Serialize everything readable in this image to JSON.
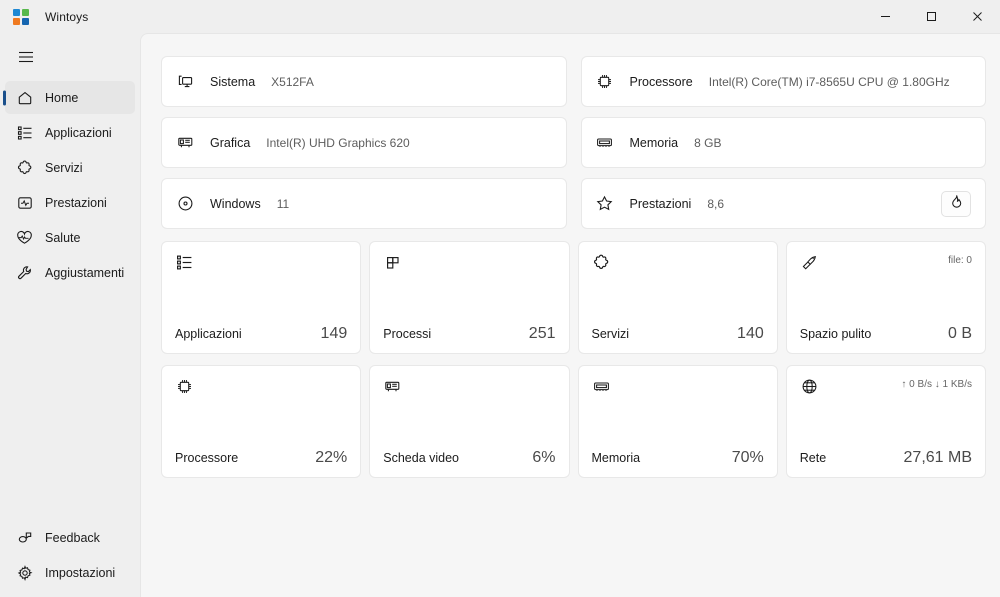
{
  "window": {
    "title": "Wintoys",
    "logo_icon": "wintoys-logo-icon",
    "minimize_label": "─",
    "maximize_label": "□",
    "close_label": "✕"
  },
  "sidebar": {
    "menu_toggle_icon": "hamburger-icon",
    "items": [
      {
        "label": "Home",
        "icon": "home-icon",
        "selected": true
      },
      {
        "label": "Applicazioni",
        "icon": "list-icon",
        "selected": false
      },
      {
        "label": "Servizi",
        "icon": "puzzle-icon",
        "selected": false
      },
      {
        "label": "Prestazioni",
        "icon": "pulse-icon",
        "selected": false
      },
      {
        "label": "Salute",
        "icon": "heart-pulse-icon",
        "selected": false
      },
      {
        "label": "Aggiustamenti",
        "icon": "wrench-icon",
        "selected": false
      }
    ],
    "bottom_items": [
      {
        "label": "Feedback",
        "icon": "feedback-icon"
      },
      {
        "label": "Impostazioni",
        "icon": "gear-icon"
      }
    ]
  },
  "info_cards": [
    {
      "label": "Sistema",
      "value": "X512FA",
      "icon": "device-icon"
    },
    {
      "label": "Processore",
      "value": "Intel(R) Core(TM) i7-8565U CPU @ 1.80GHz",
      "icon": "cpu-icon"
    },
    {
      "label": "Grafica",
      "value": "Intel(R) UHD Graphics 620",
      "icon": "gpu-icon"
    },
    {
      "label": "Memoria",
      "value": "8 GB",
      "icon": "ram-icon"
    },
    {
      "label": "Windows",
      "value": "11",
      "icon": "disc-icon"
    },
    {
      "label": "Prestazioni",
      "value": "8,6",
      "icon": "star-icon",
      "action_icon": "flame-icon"
    }
  ],
  "tiles": [
    {
      "label": "Applicazioni",
      "value": "149",
      "sub": "",
      "icon": "list-icon"
    },
    {
      "label": "Processi",
      "value": "251",
      "sub": "",
      "icon": "processes-icon"
    },
    {
      "label": "Servizi",
      "value": "140",
      "sub": "",
      "icon": "puzzle-icon"
    },
    {
      "label": "Spazio pulito",
      "value": "0 B",
      "sub": "file: 0",
      "icon": "broom-icon"
    },
    {
      "label": "Processore",
      "value": "22%",
      "sub": "",
      "icon": "cpu-icon"
    },
    {
      "label": "Scheda video",
      "value": "6%",
      "sub": "",
      "icon": "gpu-icon"
    },
    {
      "label": "Memoria",
      "value": "70%",
      "sub": "",
      "icon": "ram-icon"
    },
    {
      "label": "Rete",
      "value": "27,61 MB",
      "sub": "↑ 0 B/s  ↓ 1 KB/s",
      "icon": "globe-icon"
    }
  ],
  "colors": {
    "accent": "#1a4f8b",
    "sidebar_bg": "#efefef",
    "content_bg": "#f6f6f6",
    "card_bg": "#ffffff",
    "text": "#1b1b1b",
    "muted_text": "#5d5d5d"
  }
}
